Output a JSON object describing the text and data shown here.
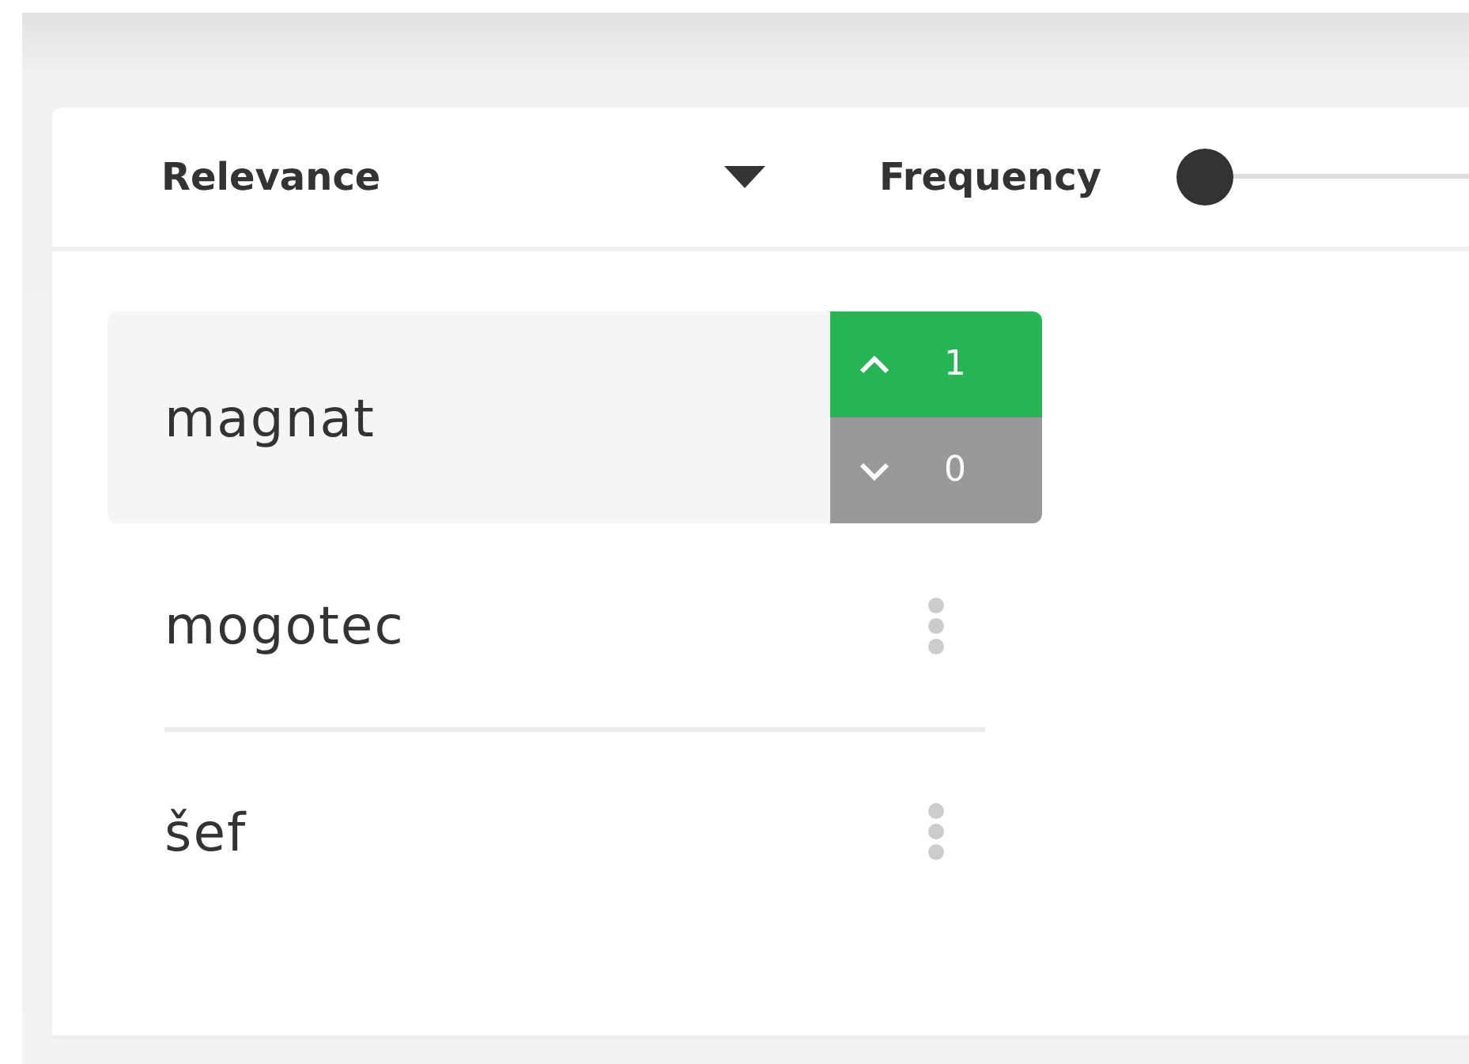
{
  "toolbar": {
    "sort": {
      "label": "Relevance"
    },
    "frequency": {
      "label": "Frequency",
      "level": 0
    }
  },
  "words": [
    {
      "text": "magnat",
      "hovered": true,
      "votes": {
        "up": "1",
        "down": "0",
        "upvoted": true,
        "downvoted": false
      }
    },
    {
      "text": "mogotec",
      "hovered": false
    },
    {
      "text": "šef",
      "hovered": false
    }
  ]
}
